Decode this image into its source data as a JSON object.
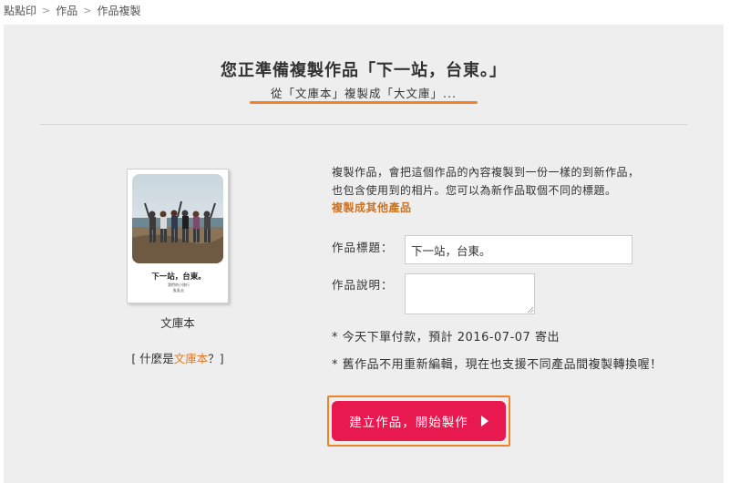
{
  "breadcrumb": {
    "items": [
      "點點印",
      "作品",
      "作品複製"
    ],
    "separator": ">"
  },
  "page": {
    "heading": "您正準備複製作品「下一站，台東。」",
    "subheading": "從「文庫本」複製成「大文庫」...",
    "accent_color": "#f08228"
  },
  "product": {
    "cover_title": "下一站，台東。",
    "cover_subtitle": "我們的小旅行",
    "cover_author": "亂亂去",
    "name": "文庫本",
    "what_is_prefix": "[ 什麼是",
    "what_is_link": "文庫本",
    "what_is_suffix": "？]"
  },
  "form": {
    "intro_line1": "複製作品，會把這個作品的內容複製到一份一樣的到新作品，",
    "intro_line2": "也包含使用到的相片。您可以為新作品取個不同的標題。",
    "other_products_link": "複製成其他產品",
    "title_label": "作品標題：",
    "title_value": "下一站，台東。",
    "description_label": "作品說明：",
    "description_value": "",
    "note_order": "* 今天下單付款，預計 2016-07-07 寄出",
    "note_convert": "* 舊作品不用重新編輯，現在也支援不同產品間複製轉換喔！",
    "submit_label": "建立作品，開始製作",
    "submit_color": "#e8194f",
    "submit_icon": "play-triangle-icon"
  }
}
